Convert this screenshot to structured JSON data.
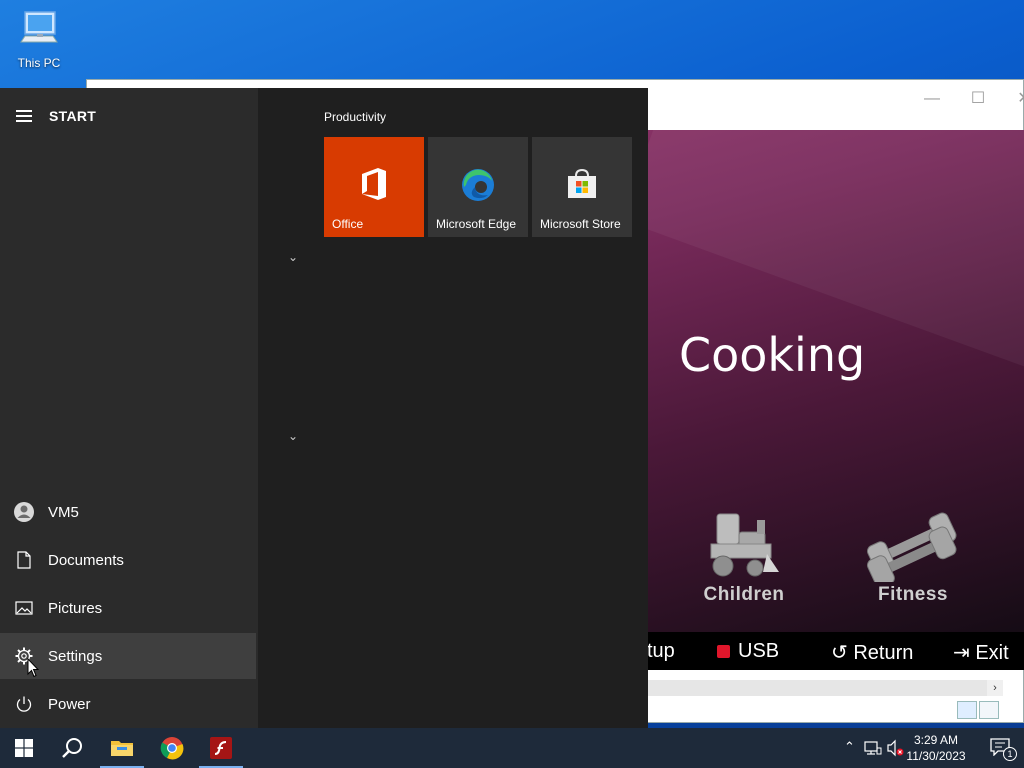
{
  "desktop": {
    "icon_label": "This PC"
  },
  "app_window": {
    "controls": {
      "minimize": "—",
      "maximize": "☐",
      "close": "✕"
    },
    "heading": "Cooking",
    "categories": [
      "Children",
      "Fitness"
    ],
    "menu": {
      "setup": "tup",
      "usb": "USB",
      "return": "Return",
      "exit": "Exit"
    },
    "usb_color": "#e0162b"
  },
  "start_menu": {
    "header": "START",
    "nav": [
      {
        "label": "VM5",
        "icon": "user-icon"
      },
      {
        "label": "Documents",
        "icon": "document-icon"
      },
      {
        "label": "Pictures",
        "icon": "pictures-icon"
      },
      {
        "label": "Settings",
        "icon": "gear-icon"
      },
      {
        "label": "Power",
        "icon": "power-icon"
      }
    ],
    "group_title": "Productivity",
    "tiles": [
      {
        "label": "Office",
        "icon": "office-icon",
        "color": "#d83b01"
      },
      {
        "label": "Microsoft Edge",
        "icon": "edge-icon",
        "color": "#353535"
      },
      {
        "label": "Microsoft Store",
        "icon": "store-icon",
        "color": "#353535"
      }
    ]
  },
  "taskbar": {
    "time": "3:29 AM",
    "date": "11/30/2023",
    "notification_count": "1",
    "accent": "#7ab0f0"
  }
}
